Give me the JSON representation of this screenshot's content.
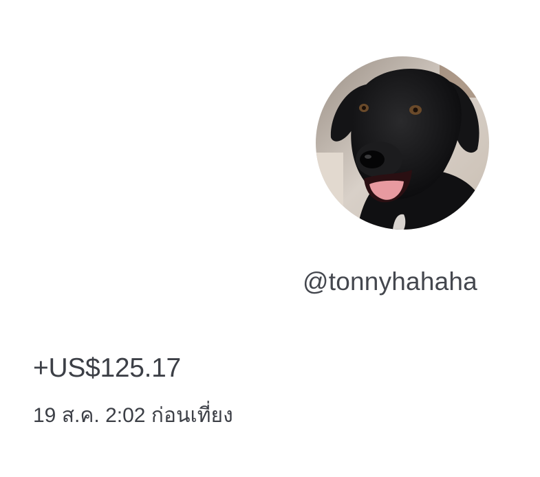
{
  "profile": {
    "avatar_icon": "dog-avatar",
    "handle": "@tonnyhahaha"
  },
  "transaction": {
    "amount": "+US$125.17",
    "timestamp": "19 ส.ค. 2:02 ก่อนเที่ยง"
  },
  "colors": {
    "text": "#3c3f46",
    "background": "#ffffff"
  }
}
